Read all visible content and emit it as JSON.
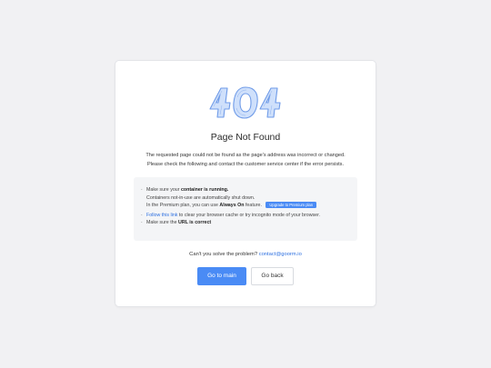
{
  "error": {
    "code": "404",
    "title": "Page Not Found",
    "desc_line1": "The requested page could not be found as the page's address was incorrect or changed.",
    "desc_line2": "Please check the following and contact the customer service center if the error persists."
  },
  "tips": {
    "t1_prefix": "Make sure your ",
    "t1_bold": "container is running.",
    "t1_line2": "Containers not-in-use are automatically shut down.",
    "t1_line3_prefix": "In the Premium plan, you can use ",
    "t1_line3_bold": "Always On",
    "t1_line3_suffix": " feature.",
    "premium_button": "Upgrade to Premium plan",
    "t2_link": "Follow this link",
    "t2_rest": " to clear your browser cache or try incognito mode of your browser.",
    "t3_prefix": "Make sure the ",
    "t3_bold": "URL is correct",
    "bullet": "·"
  },
  "help": {
    "text": "Can't you solve the problem? ",
    "email": "contact@goorm.io"
  },
  "actions": {
    "main_label": "Go to main",
    "back_label": "Go back"
  },
  "colors": {
    "accent": "#4a8bf5",
    "link": "#2c6fe0",
    "illustration_fill": "#cfe0fb",
    "illustration_stroke": "#6f9be8"
  }
}
